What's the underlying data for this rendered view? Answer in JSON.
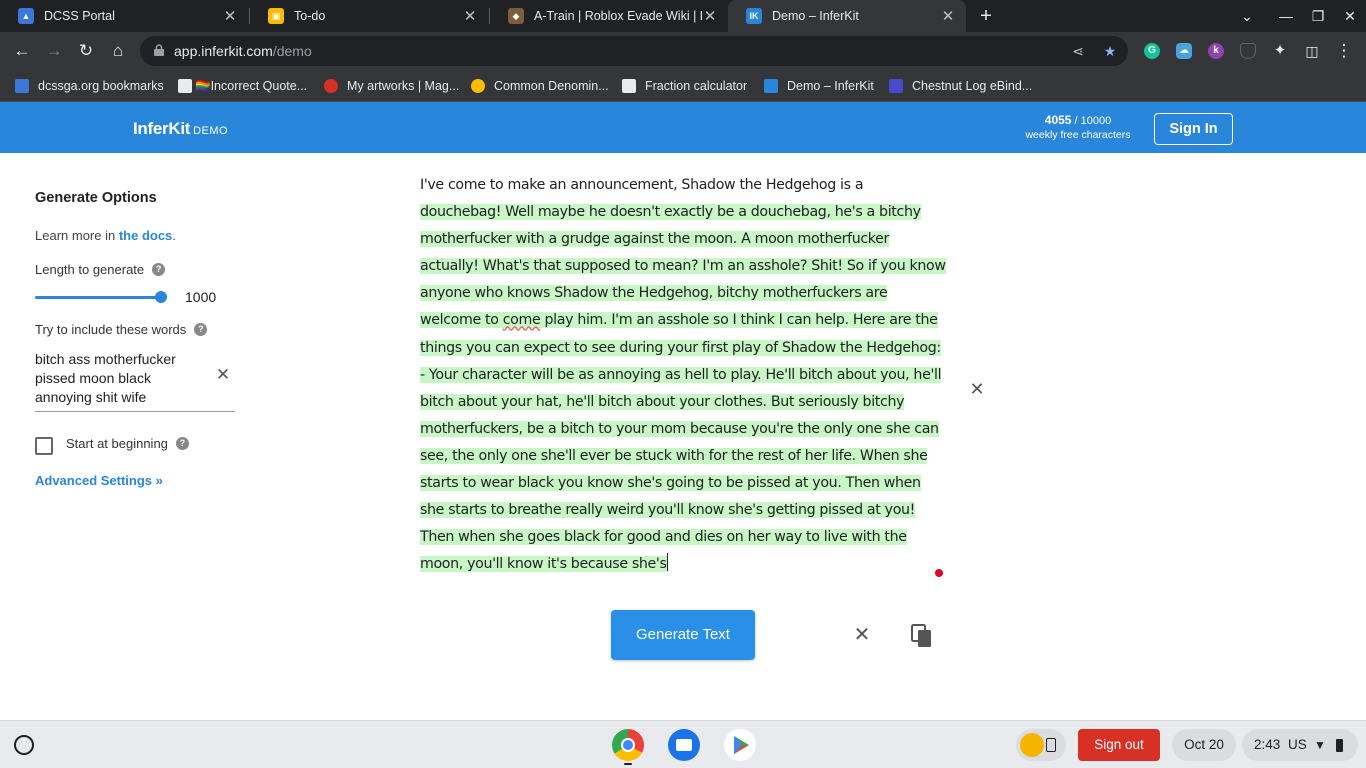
{
  "browser": {
    "tabs": [
      {
        "title": "DCSS Portal",
        "active": false,
        "favicon_color": "#3c78d8"
      },
      {
        "title": "To-do",
        "active": false,
        "favicon_color": "#fbbc04"
      },
      {
        "title": "A-Train | Roblox Evade Wiki | Far",
        "active": false,
        "favicon_color": "#7b5e3b"
      },
      {
        "title": "Demo – InferKit",
        "active": true,
        "favicon_color": "#2a86db"
      }
    ],
    "new_tab_icon": "plus-icon",
    "url_host": "app.inferkit.com",
    "url_path": "/demo",
    "bookmarks": [
      {
        "label": "dcssga.org bookmarks",
        "icon_color": "#3c78d8"
      },
      {
        "label": "🏳️‍🌈Incorrect Quote...",
        "icon_color": "#e8eaed"
      },
      {
        "label": "My artworks | Mag...",
        "icon_color": "#d93025"
      },
      {
        "label": "Common Denomin...",
        "icon_color": "#fbbc04"
      },
      {
        "label": "Fraction calculator",
        "icon_color": "#e8eaed"
      },
      {
        "label": "Demo – InferKit",
        "icon_color": "#2a86db"
      },
      {
        "label": "Chestnut Log eBind...",
        "icon_color": "#4a4ad0"
      }
    ],
    "extensions": [
      {
        "name": "grammarly-icon",
        "letter": "G",
        "color": "#15c39a"
      },
      {
        "name": "cloud-extension-icon",
        "letter": "☁",
        "color": "#4aa3df"
      },
      {
        "name": "kami-icon",
        "letter": "k",
        "color": "#8e44ad"
      },
      {
        "name": "shield-extension-icon",
        "letter": "",
        "color": "#5f6368"
      }
    ]
  },
  "header": {
    "logo": "InferKit",
    "logo_badge": "DEMO",
    "quota_used": "4055",
    "quota_total": " / 10000",
    "quota_label": "weekly free characters",
    "signin_label": "Sign In"
  },
  "sidebar": {
    "title": "Generate Options",
    "docs_prefix": "Learn more in ",
    "docs_link": "the docs",
    "docs_suffix": ".",
    "length_label": "Length to generate",
    "length_value": "1000",
    "length_fraction": 0.95,
    "words_label": "Try to include these words",
    "words_value": "bitch ass motherfucker pissed moon black annoying shit wife",
    "start_label": "Start at beginning",
    "start_checked": false,
    "advanced_label": "Advanced Settings »"
  },
  "editor": {
    "prompt": "I've come to make an announcement, Shadow the Hedgehog is a ",
    "generated_before": "douchebag! Well maybe he doesn't exactly be a douchebag, he's a bitchy motherfucker with a grudge against the moon. A moon motherfucker actually! What's that supposed to mean? I'm an asshole? Shit! So if you know anyone who knows Shadow the Hedgehog, bitchy motherfuckers are welcome to ",
    "misspelled_word": "come",
    "generated_after": " play him. I'm an asshole so I think I can help. Here are the things you can expect to see during your first play of Shadow the Hedgehog: - Your character will be as annoying as hell to play. He'll bitch about you, he'll bitch about your hat, he'll bitch about your clothes. But seriously bitchy motherfuckers, be a bitch to your mom because you're the only one she can see, the only one she'll ever be stuck with for the rest of her life. When she starts to wear black you know she's going to be pissed at you. Then when she starts to breathe really weird you'll know she's getting pissed at you! Then when she goes black for good and dies on her way to live with the moon, you'll know it's because she's",
    "generate_label": "Generate Text"
  },
  "shelf": {
    "signout_label": "Sign out",
    "date": "Oct 20",
    "time": "2:43",
    "locale": "US"
  },
  "colors": {
    "accent": "#2a86db",
    "highlight": "#c8f7c5",
    "signout": "#d93025"
  }
}
